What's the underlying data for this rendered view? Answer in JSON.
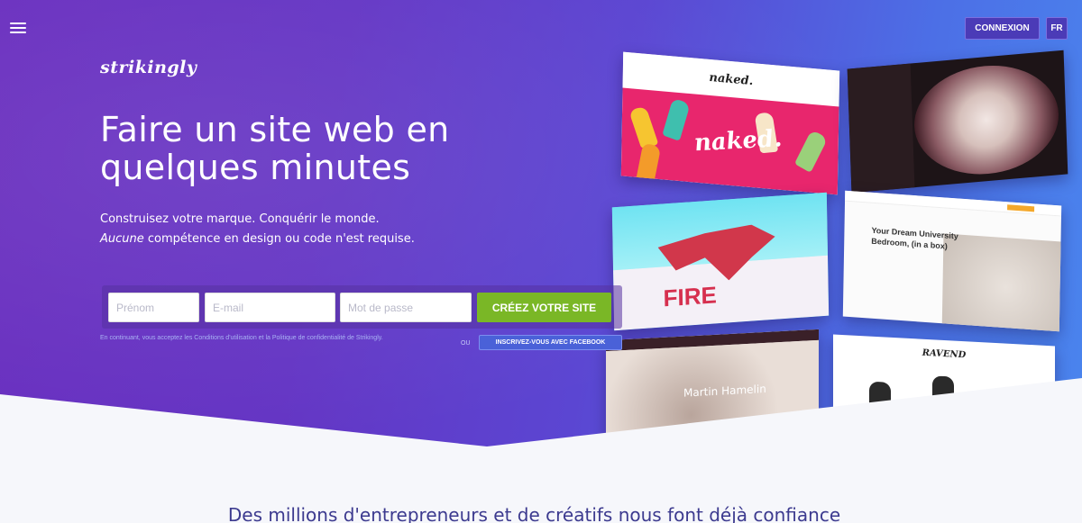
{
  "nav": {
    "connexion_label": "CONNEXION",
    "lang_label": "FR"
  },
  "brand": {
    "logo_text": "strikingly"
  },
  "hero": {
    "headline_line1": "Faire un site web en",
    "headline_line2": "quelques minutes",
    "sub_line1": "Construisez votre marque. Conquérir le monde.",
    "sub_line2_em": "Aucune",
    "sub_line2_rest": " compétence en design ou code n'est requise."
  },
  "signup": {
    "firstname_placeholder": "Prénom",
    "email_placeholder": "E-mail",
    "password_placeholder": "Mot de passe",
    "cta_label": "CRÉEZ VOTRE SITE",
    "legal_text": "En continuant, vous acceptez les Conditions d'utilisation et la Politique de confidentialité de Strikingly.",
    "or_text": "OU",
    "facebook_label": "INSCRIVEZ-VOUS AVEC FACEBOOK"
  },
  "showcase": {
    "naked_brand": "naked.",
    "fire_word": "FIRE",
    "dorm_title": "Your Dream University Bedroom, (in a box)",
    "martin_name": "Martin Hamelin",
    "ravend_brand": "RAVEND"
  },
  "trust": {
    "tagline": "Des millions d'entrepreneurs et de créatifs nous font déjà confiance"
  },
  "colors": {
    "cta_green": "#7ab726",
    "gradient_start": "#6a2fbf",
    "gradient_end": "#4a86ee"
  }
}
